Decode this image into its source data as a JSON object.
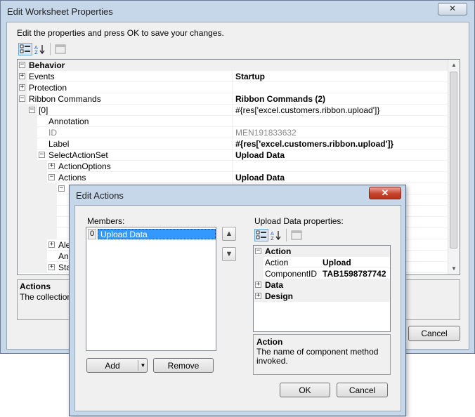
{
  "outer": {
    "title": "Edit Worksheet Properties",
    "close": "✕",
    "instructions": "Edit the properties and press OK to save your changes.",
    "cancel_label": "Cancel",
    "grid_rows": [
      {
        "name": "Behavior",
        "value": ""
      },
      {
        "name": "Events",
        "value": "Startup"
      },
      {
        "name": "Protection",
        "value": ""
      },
      {
        "name": "Ribbon Commands",
        "value": "Ribbon Commands (2)"
      },
      {
        "name": "[0]",
        "value": "#{res['excel.customers.ribbon.upload']}"
      },
      {
        "name": "Annotation",
        "value": ""
      },
      {
        "name": "ID",
        "value": "MEN191833632"
      },
      {
        "name": "Label",
        "value": "#{res['excel.customers.ribbon.upload']}"
      },
      {
        "name": "SelectActionSet",
        "value": "Upload Data"
      },
      {
        "name": "ActionOptions",
        "value": ""
      },
      {
        "name": "Actions",
        "value": "Upload Data"
      },
      {
        "name": "Ale",
        "value": ""
      },
      {
        "name": "Ann",
        "value": ""
      },
      {
        "name": "Sta",
        "value": ""
      }
    ],
    "desc_title": "Actions",
    "desc_text": "The collection"
  },
  "inner": {
    "title": "Edit Actions",
    "close": "✕",
    "members_label": "Members:",
    "members": [
      {
        "index": "0",
        "label": "Upload Data"
      }
    ],
    "add_label": "Add",
    "remove_label": "Remove",
    "props_label": "Upload Data properties:",
    "grid_rows": [
      {
        "name": "Action",
        "value": ""
      },
      {
        "name": "Action",
        "value": "Upload"
      },
      {
        "name": "ComponentID",
        "value": "TAB1598787742"
      },
      {
        "name": "Data",
        "value": ""
      },
      {
        "name": "Design",
        "value": ""
      }
    ],
    "desc_title": "Action",
    "desc_text": "The name of component method invoked.",
    "ok_label": "OK",
    "cancel_label": "Cancel"
  },
  "icons": {
    "categorized": "categorized-icon",
    "alphabetical": "alphabetical-sort-icon",
    "property_pages": "property-pages-icon",
    "move_up": "arrow-up-icon",
    "move_down": "arrow-down-icon"
  },
  "colors": {
    "titlebar": "#c7d7ea",
    "selection": "#3399ff",
    "close_red": "#c8452d"
  }
}
